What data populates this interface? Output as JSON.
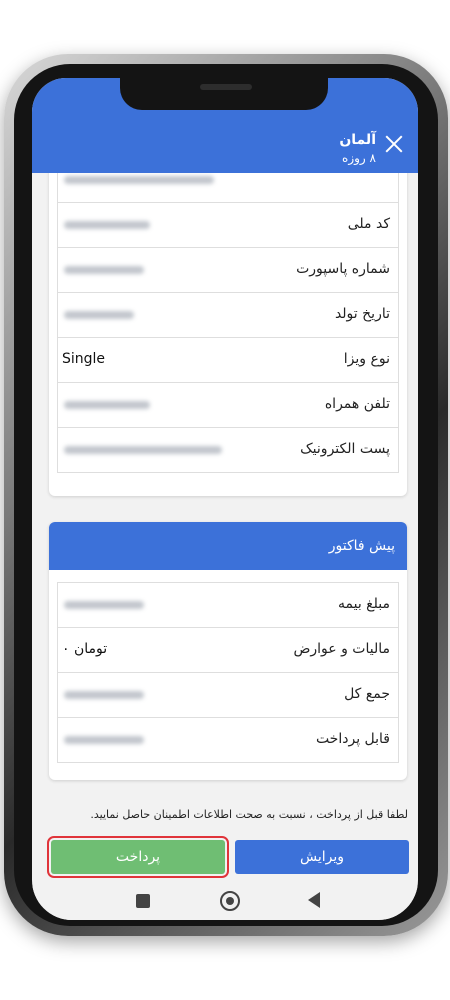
{
  "header": {
    "country": "آلمان",
    "duration": "۸ روزه"
  },
  "passenger_info": {
    "rows": [
      {
        "label": "",
        "value": "FAEZE REZAEIRAUF"
      },
      {
        "label": "کد ملی",
        "value": ""
      },
      {
        "label": "شماره پاسپورت",
        "value": ""
      },
      {
        "label": "تاریخ تولد",
        "value": ""
      },
      {
        "label": "نوع ویزا",
        "value": "Single"
      },
      {
        "label": "تلفن همراه",
        "value": ""
      },
      {
        "label": "پست الکترونیک",
        "value": ""
      }
    ]
  },
  "invoice": {
    "title": "پیش فاکتور",
    "rows": [
      {
        "label": "مبلغ بیمه",
        "value": ""
      },
      {
        "label": "مالیات و عوارض",
        "value": "۰ تومان"
      },
      {
        "label": "جمع کل",
        "value": ""
      },
      {
        "label": "قابل پرداخت",
        "value": ""
      }
    ]
  },
  "notice": "لطفا قبل از پرداخت ، نسبت به صحت اطلاعات اطمینان حاصل نمایید.",
  "buttons": {
    "pay": "پرداخت",
    "edit": "ویرایش"
  },
  "colors": {
    "primary": "#3c71d9",
    "pay_button": "#6fbe73",
    "highlight": "#e0343a"
  },
  "icons": [
    "close-icon",
    "nav-recent-icon",
    "nav-home-icon",
    "nav-back-icon"
  ]
}
